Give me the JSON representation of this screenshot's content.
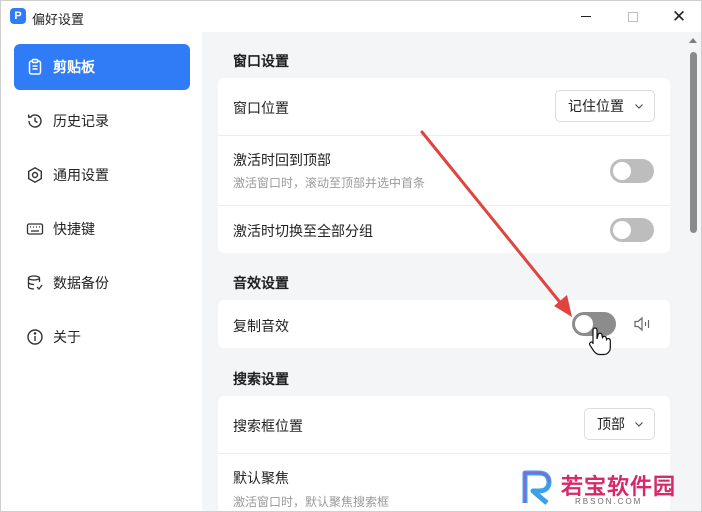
{
  "window": {
    "title": "偏好设置",
    "app_icon_letter": "P"
  },
  "sidebar": {
    "items": [
      {
        "label": "剪贴板",
        "icon": "clipboard-icon",
        "active": true
      },
      {
        "label": "历史记录",
        "icon": "history-icon",
        "active": false
      },
      {
        "label": "通用设置",
        "icon": "settings-icon",
        "active": false
      },
      {
        "label": "快捷键",
        "icon": "keyboard-icon",
        "active": false
      },
      {
        "label": "数据备份",
        "icon": "database-icon",
        "active": false
      },
      {
        "label": "关于",
        "icon": "info-icon",
        "active": false
      }
    ]
  },
  "sections": {
    "window": {
      "title": "窗口设置",
      "position_label": "窗口位置",
      "position_value": "记住位置",
      "back_to_top_label": "激活时回到顶部",
      "back_to_top_desc": "激活窗口时，滚动至顶部并选中首条",
      "back_to_top_on": false,
      "switch_group_label": "激活时切换至全部分组",
      "switch_group_on": false
    },
    "sound": {
      "title": "音效设置",
      "copy_sound_label": "复制音效",
      "copy_sound_on": false
    },
    "search": {
      "title": "搜索设置",
      "box_position_label": "搜索框位置",
      "box_position_value": "顶部",
      "default_focus_label": "默认聚焦",
      "default_focus_desc": "激活窗口时，默认聚焦搜索框"
    }
  },
  "colors": {
    "accent": "#2f7cf6",
    "arrow": "#e0443f",
    "toggle_off": "#8c8c8c",
    "content_bg": "#f4f5f7"
  },
  "watermark": {
    "text": "若宝软件园",
    "sub": "RBSON.COM"
  }
}
